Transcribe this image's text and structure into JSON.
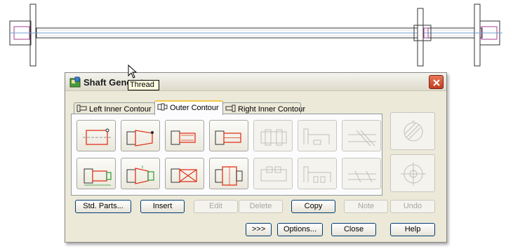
{
  "window": {
    "title": "Shaft Generator"
  },
  "tabs": [
    {
      "label": "Left Inner Contour"
    },
    {
      "label": "Outer Contour"
    },
    {
      "label": "Right Inner Contour"
    }
  ],
  "tools": {
    "row1": [
      "cylinder-tool",
      "cone-tool",
      "thread-tool",
      "profile-tool",
      "spline-tool",
      "groove-tool",
      "polygon-tool"
    ],
    "row2": [
      "bearing-section-tool",
      "chamfer-section-tool",
      "wedge-section-tool",
      "ring-section-tool",
      "key-tool",
      "undercut-tool",
      "cut-tool"
    ]
  },
  "tooltip": "Thread",
  "buttons": {
    "std_parts": "Std. Parts...",
    "insert": "Insert",
    "edit": "Edit",
    "delete": "Delete",
    "copy": "Copy",
    "note": "Note",
    "undo": "Undo",
    "more": ">>>",
    "options": "Options...",
    "close": "Close",
    "help": "Help"
  },
  "colors": {
    "accent_red": "#e0341a",
    "accent_green": "#2c9a3a",
    "tab_highlight": "#f5c64a"
  }
}
